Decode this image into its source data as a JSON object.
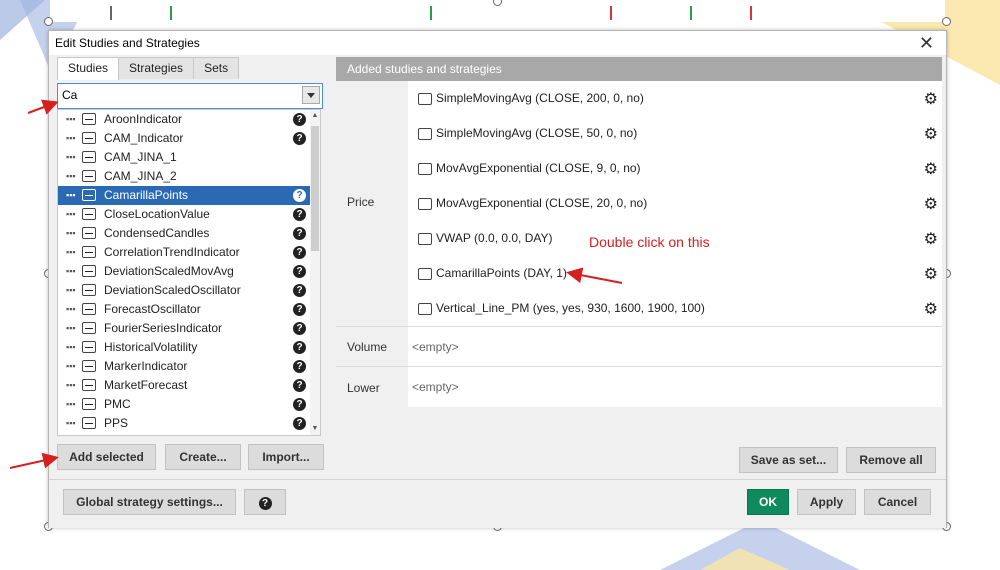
{
  "dialog": {
    "title": "Edit Studies and Strategies",
    "close_label": "✕"
  },
  "tabs": [
    {
      "label": "Studies",
      "active": true
    },
    {
      "label": "Strategies",
      "active": false
    },
    {
      "label": "Sets",
      "active": false
    }
  ],
  "search": {
    "value": "Ca"
  },
  "study_list": [
    {
      "name": "AroonIndicator",
      "help": true,
      "selected": false
    },
    {
      "name": "CAM_Indicator",
      "help": true,
      "selected": false
    },
    {
      "name": "CAM_JINA_1",
      "help": false,
      "selected": false
    },
    {
      "name": "CAM_JINA_2",
      "help": false,
      "selected": false
    },
    {
      "name": "CamarillaPoints",
      "help": true,
      "selected": true
    },
    {
      "name": "CloseLocationValue",
      "help": true,
      "selected": false
    },
    {
      "name": "CondensedCandles",
      "help": true,
      "selected": false
    },
    {
      "name": "CorrelationTrendIndicator",
      "help": true,
      "selected": false
    },
    {
      "name": "DeviationScaledMovAvg",
      "help": true,
      "selected": false
    },
    {
      "name": "DeviationScaledOscillator",
      "help": true,
      "selected": false
    },
    {
      "name": "ForecastOscillator",
      "help": true,
      "selected": false
    },
    {
      "name": "FourierSeriesIndicator",
      "help": true,
      "selected": false
    },
    {
      "name": "HistoricalVolatility",
      "help": true,
      "selected": false
    },
    {
      "name": "MarkerIndicator",
      "help": true,
      "selected": false
    },
    {
      "name": "MarketForecast",
      "help": true,
      "selected": false
    },
    {
      "name": "PMC",
      "help": true,
      "selected": false
    },
    {
      "name": "PPS",
      "help": true,
      "selected": false
    }
  ],
  "help_glyph": "?",
  "left_buttons": {
    "add_selected": "Add selected",
    "create": "Create...",
    "import": "Import..."
  },
  "added": {
    "header": "Added studies and strategies",
    "price_label": "Price",
    "price_studies": [
      "SimpleMovingAvg (CLOSE, 200, 0, no)",
      "SimpleMovingAvg (CLOSE, 50, 0, no)",
      "MovAvgExponential (CLOSE, 9, 0, no)",
      "MovAvgExponential (CLOSE, 20, 0, no)",
      "VWAP (0.0, 0.0, DAY)",
      "CamarillaPoints (DAY, 1)",
      "Vertical_Line_PM (yes, yes, 930, 1600, 1900, 100)"
    ],
    "volume_label": "Volume",
    "volume_value": "<empty>",
    "lower_label": "Lower",
    "lower_value": "<empty>"
  },
  "right_buttons": {
    "save_as_set": "Save as set...",
    "remove_all": "Remove all"
  },
  "bottom": {
    "global_settings": "Global strategy settings...",
    "help": "?",
    "ok": "OK",
    "apply": "Apply",
    "cancel": "Cancel"
  },
  "annotation": {
    "text": "Double click on this"
  },
  "colors": {
    "accent_selected": "#2a6ab4",
    "ok_button": "#0f8a5e",
    "annotation": "#d62020",
    "header_bg": "#a8a8a8"
  }
}
